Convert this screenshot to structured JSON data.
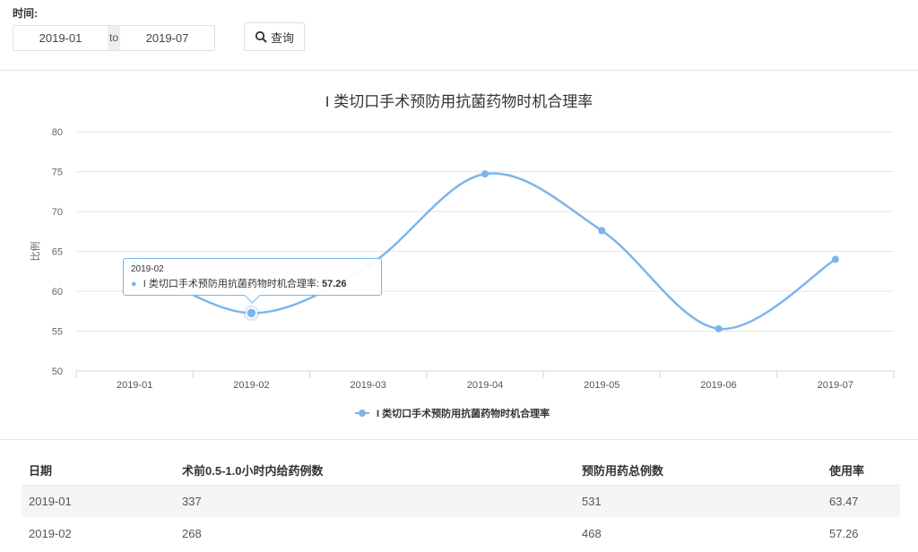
{
  "filter": {
    "label": "时间:",
    "start": "2019-01",
    "separator": "to",
    "end": "2019-07",
    "query_label": "查询"
  },
  "chart_data": {
    "type": "line",
    "smooth": true,
    "title": "I 类切口手术预防用抗菌药物时机合理率",
    "ylabel": "比例",
    "ylim": [
      50,
      80
    ],
    "yticks": [
      50,
      55,
      60,
      65,
      70,
      75,
      80
    ],
    "categories": [
      "2019-01",
      "2019-02",
      "2019-03",
      "2019-04",
      "2019-05",
      "2019-06",
      "2019-07"
    ],
    "series": [
      {
        "name": "I 类切口手术预防用抗菌药物时机合理率",
        "values": [
          63.47,
          57.26,
          63.2,
          74.7,
          67.6,
          55.3,
          64.0
        ],
        "color": "#7cb5ec"
      }
    ],
    "legend": "bottom-center",
    "grid": true
  },
  "tooltip": {
    "date": "2019-02",
    "series": "I 类切口手术预防用抗菌药物时机合理率",
    "value": "57.26"
  },
  "table": {
    "headers": [
      "日期",
      "术前0.5-1.0小时内给药例数",
      "预防用药总例数",
      "使用率"
    ],
    "rows": [
      [
        "2019-01",
        "337",
        "531",
        "63.47"
      ],
      [
        "2019-02",
        "268",
        "468",
        "57.26"
      ]
    ]
  }
}
